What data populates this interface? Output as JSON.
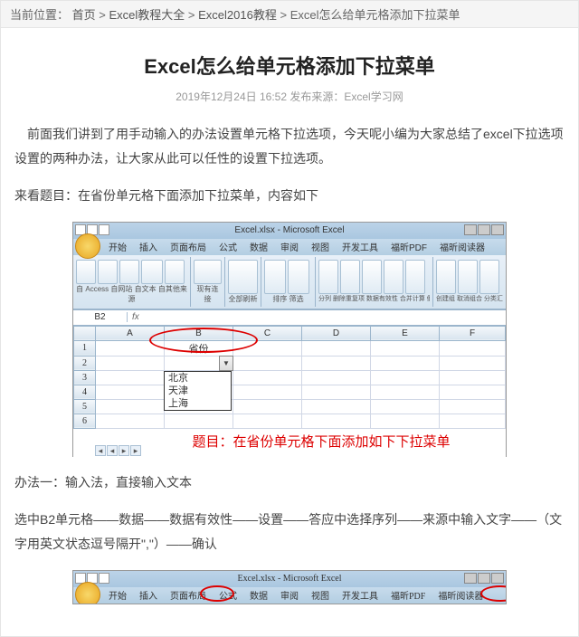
{
  "breadcrumb": {
    "label": "当前位置：",
    "items": [
      "首页",
      "Excel教程大全",
      "Excel2016教程",
      "Excel怎么给单元格添加下拉菜单"
    ],
    "sep": " > "
  },
  "title": "Excel怎么给单元格添加下拉菜单",
  "meta": {
    "date": "2019年12月24日 16:52",
    "source_label": "发布来源：",
    "source": "Excel学习网"
  },
  "content": {
    "intro": "　前面我们讲到了用手动输入的办法设置单元格下拉选项，今天呢小编为大家总结了excel下拉选项设置的两种办法，让大家从此可以任性的设置下拉选项。",
    "topic_lead": "来看题目：在省份单元格下面添加下拉菜单，内容如下",
    "method1": "办法一：输入法，直接输入文本",
    "method1_steps": "选中B2单元格——数据——数据有效性——设置——答应中选择序列——来源中输入文字——（文字用英文状态逗号隔开\",\"）——确认"
  },
  "excel1": {
    "app_title": "Excel.xlsx - Microsoft Excel",
    "tabs": [
      "开始",
      "插入",
      "页面布局",
      "公式",
      "数据",
      "审阅",
      "视图",
      "开发工具",
      "福昕PDF",
      "福昕阅读器"
    ],
    "ribbon_labels": [
      "自 Access  自网站  自文本  自其他来源",
      "现有连接",
      "全部刷新",
      "排序  筛选",
      "分列  删除重复项  数据有效性  合并计算  假设分析",
      "创建组  取消组合  分类汇总"
    ],
    "namebox": "B2",
    "col_headers": [
      "A",
      "B",
      "C",
      "D",
      "E",
      "F"
    ],
    "row_headers": [
      "1",
      "2",
      "3",
      "4",
      "5",
      "6"
    ],
    "cell_b1": "省份",
    "dropdown_items": [
      "北京",
      "天津",
      "上海"
    ],
    "caption": "题目：在省份单元格下面添加如下下拉菜单"
  },
  "excel2": {
    "app_title": "Excel.xlsx - Microsoft Excel",
    "tabs": [
      "开始",
      "插入",
      "页面布局",
      "公式",
      "数据",
      "审阅",
      "视图",
      "开发工具",
      "福昕PDF",
      "福昕阅读器"
    ]
  }
}
